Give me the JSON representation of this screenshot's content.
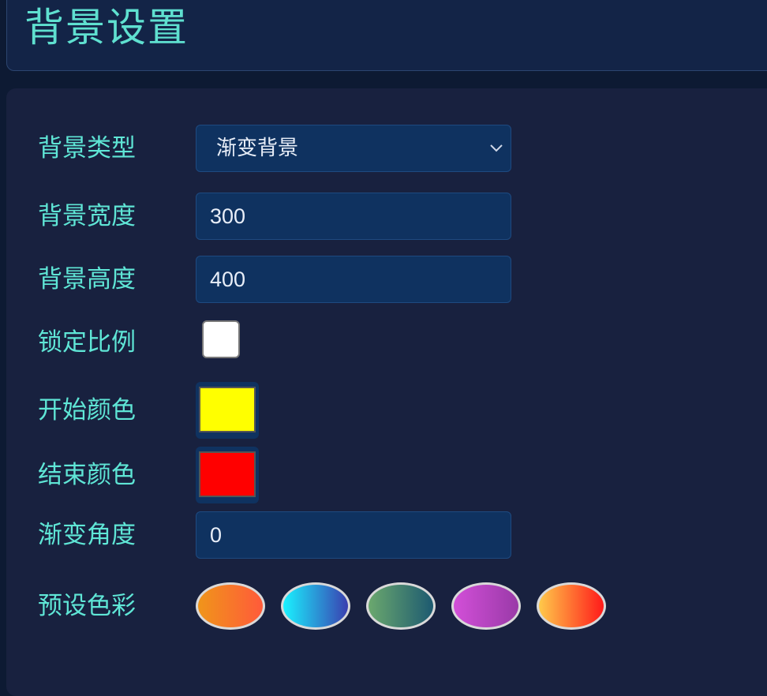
{
  "header": {
    "title": "背景设置"
  },
  "form": {
    "bg_type": {
      "label": "背景类型",
      "value": "渐变背景"
    },
    "bg_width": {
      "label": "背景宽度",
      "value": "300"
    },
    "bg_height": {
      "label": "背景高度",
      "value": "400"
    },
    "lock_ratio": {
      "label": "锁定比例",
      "checked": false
    },
    "start_color": {
      "label": "开始颜色",
      "value": "#ffff00"
    },
    "end_color": {
      "label": "结束颜色",
      "value": "#ff0000"
    },
    "gradient_angle": {
      "label": "渐变角度",
      "value": "0"
    },
    "presets": {
      "label": "预设色彩",
      "items": [
        {
          "icon": "orange-gradient-swatch",
          "from": "#f0951a",
          "to": "#ff5a3a"
        },
        {
          "icon": "cyan-blue-gradient-swatch",
          "from": "#1af2ff",
          "to": "#3a3fb0"
        },
        {
          "icon": "green-teal-gradient-swatch",
          "from": "#6ba86e",
          "to": "#1d5a70"
        },
        {
          "icon": "magenta-purple-gradient-swatch",
          "from": "#d24fd8",
          "to": "#9a3aa8"
        },
        {
          "icon": "yellow-red-gradient-swatch",
          "from": "#ffc94a",
          "to": "#ff1a1a"
        }
      ]
    }
  },
  "colors": {
    "accent": "#5fe6d6",
    "panel": "#18213f",
    "field": "#0f3260"
  }
}
